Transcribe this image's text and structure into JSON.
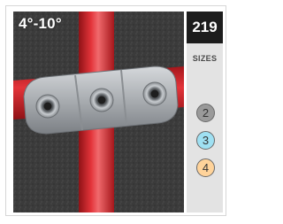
{
  "product": {
    "angle_range": "4°-10°",
    "code": "219",
    "sizes_label": "SIZES",
    "sizes": [
      {
        "label": "2",
        "color": "#9a9a9a"
      },
      {
        "label": "3",
        "color": "#9fe0f2"
      },
      {
        "label": "4",
        "color": "#ffd39a"
      }
    ]
  },
  "colors": {
    "pipe_red": "#d8262b",
    "fitting_gray": "#a9adb1",
    "code_background": "#1c1c1c",
    "sidebar_background": "#e3e3e3"
  }
}
